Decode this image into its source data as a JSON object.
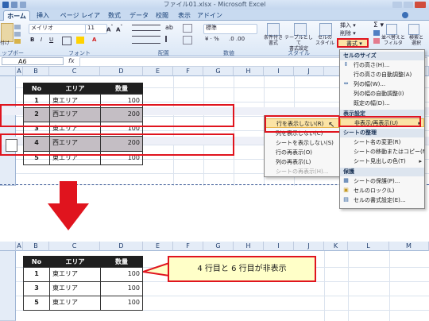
{
  "window": {
    "title": "ファイル01.xlsx - Microsoft Excel"
  },
  "tabs": [
    "ホーム",
    "挿入",
    "ページ レイアウト",
    "数式",
    "データ",
    "校閲",
    "表示",
    "アドイン"
  ],
  "ribbon": {
    "clipboard_label": "ップボード",
    "paste_label": "付け",
    "font_name": "メイリオ",
    "font_size": "11",
    "font_group_label": "フォント",
    "align_group_label": "配置",
    "number_format": "標準",
    "number_group_label": "数値",
    "style_group_label": "スタイル",
    "cond_format_label": "条件付き\n書式",
    "table_format_label": "テーブルとして\n書式設定",
    "cell_style_label": "セルの\nスタイル",
    "insert_label": "挿入",
    "delete_label": "削除",
    "format_label": "書式",
    "sort_label": "並べ替えと\nフィルタ",
    "find_label": "検索と\n選択"
  },
  "formula_bar": {
    "name_box": "A6"
  },
  "columns": [
    "A",
    "B",
    "C",
    "D",
    "E",
    "F",
    "G",
    "H",
    "I",
    "J",
    "K",
    "L",
    "M"
  ],
  "table_top": {
    "headers": [
      "No",
      "エリア",
      "数量"
    ],
    "rows": [
      {
        "no": "1",
        "area": "東エリア",
        "qty": "100"
      },
      {
        "no": "2",
        "area": "西エリア",
        "qty": "200"
      },
      {
        "no": "3",
        "area": "東エリア",
        "qty": "100"
      },
      {
        "no": "4",
        "area": "西エリア",
        "qty": "200"
      },
      {
        "no": "5",
        "area": "東エリア",
        "qty": "100"
      }
    ]
  },
  "table_bottom": {
    "headers": [
      "No",
      "エリア",
      "数量"
    ],
    "rows": [
      {
        "no": "1",
        "area": "東エリア",
        "qty": "100"
      },
      {
        "no": "3",
        "area": "東エリア",
        "qty": "100"
      },
      {
        "no": "5",
        "area": "東エリア",
        "qty": "100"
      }
    ]
  },
  "format_menu": {
    "cell_size_heading": "セルのサイズ",
    "row_height": "行の高さ(H)...",
    "row_autofit": "行の高さの自動調整(A)",
    "col_width": "列の幅(W)...",
    "col_autofit": "列の幅の自動調整(I)",
    "default_width": "既定の幅(D)...",
    "visibility_heading": "表示設定",
    "hide_unhide": "非表示/再表示(U)",
    "organize_heading": "シートの整理",
    "rename_sheet": "シート名の変更(R)",
    "move_copy": "シートの移動またはコピー(M)...",
    "tab_color": "シート見出しの色(T)",
    "protect_heading": "保護",
    "protect_sheet": "シートの保護(P)...",
    "lock_cell": "セルのロック(L)",
    "format_cells": "セルの書式設定(E)..."
  },
  "hide_submenu": {
    "hide_rows": "行を表示しない(R)",
    "hide_cols": "列を表示しない(C)",
    "hide_sheet": "シートを表示しない(S)",
    "unhide_rows": "行の再表示(O)",
    "unhide_cols": "列の再表示(L)",
    "unhide_sheet": "シートの再表示(H)..."
  },
  "callout": {
    "text": "4 行目と 6 行目が非表示"
  },
  "colors": {
    "red": "#e0141e",
    "highlight": "#fbe3a5",
    "gray_row": "#c4bec4",
    "header_black": "#1f1f1f"
  }
}
